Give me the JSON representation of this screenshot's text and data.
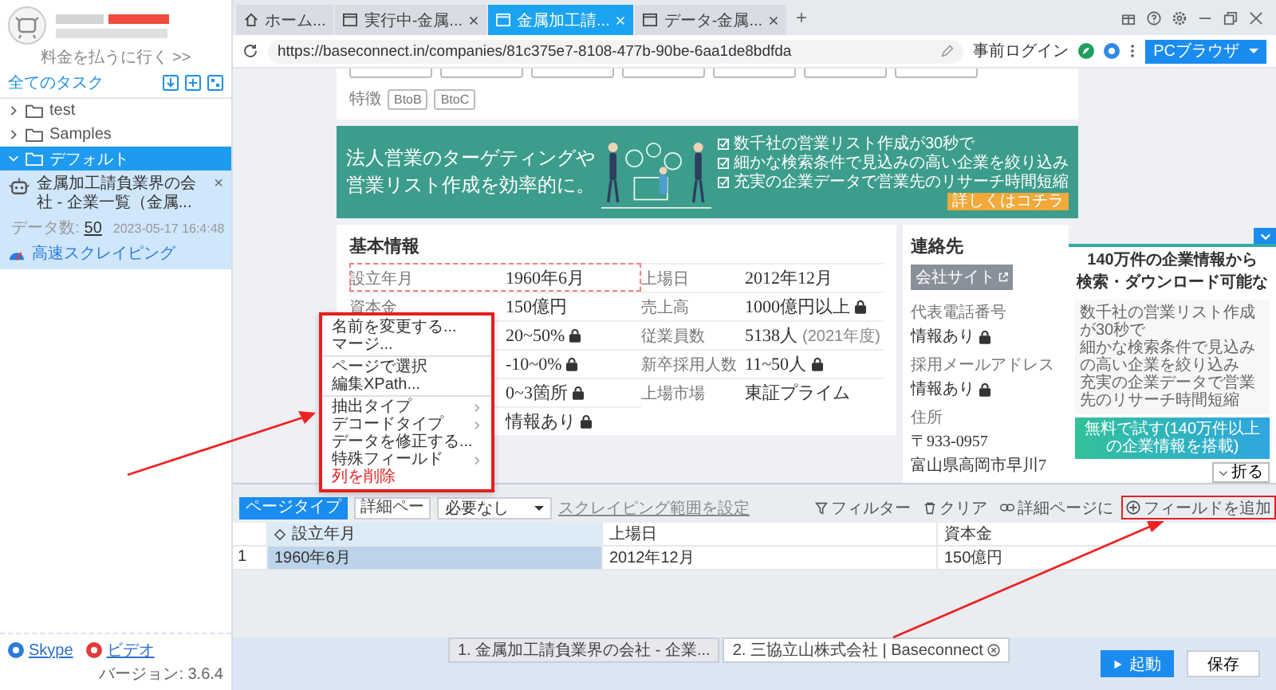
{
  "sidebar": {
    "billing_link": "料金を払うに行く >>",
    "tasks_header": "全てのタスク",
    "tree": [
      {
        "label": "test",
        "expanded": false,
        "selected": false
      },
      {
        "label": "Samples",
        "expanded": false,
        "selected": false
      },
      {
        "label": "デフォルト",
        "expanded": true,
        "selected": true,
        "children": [
          {
            "title": "金属加工請負業界の会社 - 企業一覧（金属...",
            "data_count_label": "データ数:",
            "data_count": "50",
            "time": "2023-05-17 16:4:48",
            "close": "×",
            "mode": "高速スクレイピング"
          }
        ]
      }
    ],
    "footer_links": [
      {
        "label": "Skype",
        "kind": "skype"
      },
      {
        "label": "ビデオ",
        "kind": "video"
      }
    ],
    "version": "バージョン: 3.6.4"
  },
  "browser": {
    "tabs": [
      {
        "label": "ホーム...",
        "kind": "home",
        "selected": false,
        "closable": false
      },
      {
        "label": "実行中-金属...",
        "kind": "page",
        "selected": false,
        "closable": true
      },
      {
        "label": "金属加工請...",
        "kind": "page",
        "selected": true,
        "closable": true
      },
      {
        "label": "データ-金属...",
        "kind": "page",
        "selected": false,
        "closable": true
      }
    ],
    "new_tab": "+",
    "url": "https://baseconnect.in/companies/81c375e7-8108-477b-90be-6aa1de8bdfda",
    "prelogin": "事前ログイン",
    "browser_button": "PCブラウザ"
  },
  "page": {
    "features_label": "特徴",
    "features": [
      "BtoB",
      "BtoC"
    ],
    "banner": {
      "headline": [
        "法人営業のターゲティングや",
        "営業リスト作成を効率的に。"
      ],
      "points": [
        "数千社の営業リスト作成が30秒で",
        "細かな検索条件で見込みの高い企業を絞り込み",
        "充実の企業データで営業先のリサーチ時間短縮"
      ],
      "more": "詳しくはコチラ"
    },
    "basic_info": {
      "title": "基本情報",
      "fields": [
        {
          "label": "設立年月",
          "value": "1960年6月",
          "locked": false,
          "selected": true
        },
        {
          "label": "上場日",
          "value": "2012年12月",
          "locked": false,
          "selected": false
        },
        {
          "label": "資本金",
          "value": "150億円",
          "locked": false,
          "selected": false
        },
        {
          "label": "売上高",
          "value": "1000億円以上",
          "locked": true,
          "selected": false
        },
        {
          "value": "20~50%",
          "locked": true,
          "selected": false
        },
        {
          "label": "従業員数",
          "value": "5138人",
          "note": "(2021年度)",
          "locked": false,
          "selected": false
        },
        {
          "value": "-10~0%",
          "locked": true,
          "selected": false
        },
        {
          "label": "新卒採用人数",
          "value": "11~50人",
          "locked": true,
          "selected": false
        },
        {
          "value": "0~3箇所",
          "locked": true,
          "selected": false
        },
        {
          "label": "上場市場",
          "value": "東証プライム",
          "locked": false,
          "selected": false
        },
        {
          "value": "情報あり",
          "locked": true,
          "selected": false
        }
      ]
    },
    "contact": {
      "title": "連絡先",
      "site_button": "会社サイト",
      "fields": [
        {
          "label": "代表電話番号",
          "lines": [
            "情報あり"
          ],
          "locked": true
        },
        {
          "label": "採用メールアドレス",
          "lines": [
            "情報あり"
          ],
          "locked": true
        },
        {
          "label": "住所",
          "lines": [
            "〒933-0957",
            "富山県高岡市早川7"
          ],
          "locked": false
        }
      ]
    },
    "popup": {
      "title_lines": [
        "140万件の企業情報から",
        "検索・ダウンロード可能な"
      ],
      "points": [
        "数千社の営業リスト作成が30秒で",
        "細かな検索条件で見込みの高い企業を絞り込み",
        "充実の企業データで営業先のリサーチ時間短縮"
      ],
      "cta": "無料で試す(140万件以上の企業情報を搭載)",
      "collapse": "折る"
    }
  },
  "context_menu": {
    "highlighted": true,
    "groups": [
      [
        {
          "label": "名前を変更する...",
          "kind": "item"
        },
        {
          "label": "マージ...",
          "kind": "item"
        }
      ],
      [
        {
          "label": "ページで選択",
          "kind": "item"
        },
        {
          "label": "編集XPath...",
          "kind": "item"
        }
      ],
      [
        {
          "label": "抽出タイプ",
          "kind": "submenu"
        },
        {
          "label": "デコードタイプ",
          "kind": "submenu"
        },
        {
          "label": "データを修正する...",
          "kind": "item"
        },
        {
          "label": "特殊フィールド",
          "kind": "submenu"
        },
        {
          "label": "列を削除",
          "kind": "danger"
        }
      ]
    ]
  },
  "editor": {
    "page_types": [
      {
        "label": "ページタイプ",
        "selected": true
      },
      {
        "label": "詳細ペー",
        "selected": false
      }
    ],
    "dropdown": "必要なし",
    "range_link": "スクレイピング範囲を設定",
    "actions": [
      {
        "label": "フィルター",
        "kind": "filter",
        "highlighted": false
      },
      {
        "label": "クリア",
        "kind": "clear",
        "highlighted": false
      },
      {
        "label": "詳細ページに",
        "kind": "link",
        "highlighted": false
      },
      {
        "label": "フィールドを追加",
        "kind": "add",
        "highlighted": true
      }
    ],
    "table": {
      "columns": [
        {
          "label": "設立年月",
          "selected": true
        },
        {
          "label": "上場日",
          "selected": false
        },
        {
          "label": "資本金",
          "selected": false
        }
      ],
      "rows": [
        {
          "index": "1",
          "cells": [
            "1960年6月",
            "2012年12月",
            "150億円"
          ]
        }
      ]
    }
  },
  "run_bar": {
    "tabs": [
      {
        "label": "1. 金属加工請負業界の会社 - 企業...",
        "selected": false
      },
      {
        "label": "2. 三協立山株式会社 | Baseconnect",
        "selected": true
      }
    ],
    "start_button": "起動",
    "save_button": "保存"
  }
}
